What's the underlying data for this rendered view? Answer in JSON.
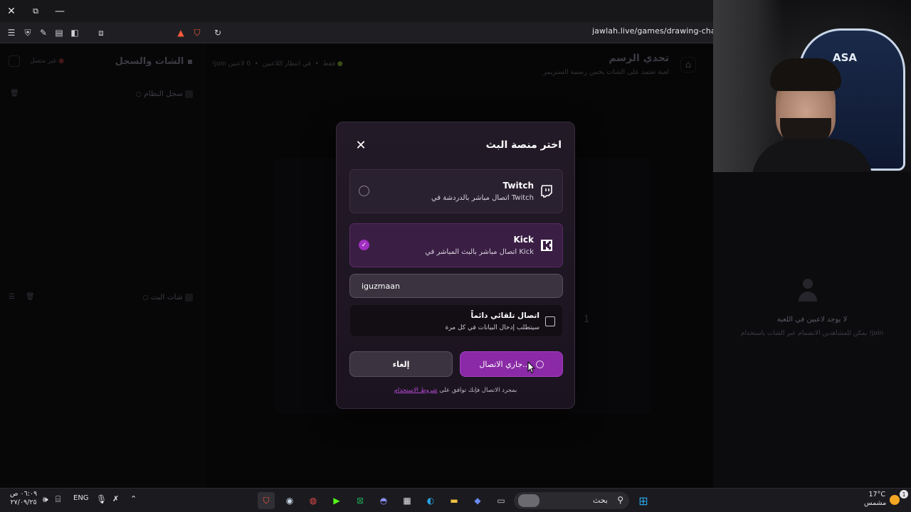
{
  "browser": {
    "url": "jawlah.live/games/drawing-challe"
  },
  "page": {
    "title": "تحدي الرسم",
    "subtitle": "لعبة تعتمد على الشات يخمن رسمة الستريمر",
    "status_players": "0 لاعبين",
    "status_waiting": "في انتظار اللاعبين",
    "status_join": "!join فقط",
    "chat_title": "الشات والسجل",
    "chat_status": "غير متصل",
    "system_log": "سجل النظام",
    "stream_chat": "شات البث",
    "round_number": "1",
    "no_players": "لا يوجد لاعبين في اللعبة",
    "no_players_hint": "يمكن للمشاهدين الانضمام عبر الشات باستخدام !join"
  },
  "modal": {
    "title": "اختر منصة البث",
    "twitch": {
      "name": "Twitch",
      "desc": "اتصال مباشر بالدردشة في Twitch"
    },
    "kick": {
      "name": "Kick",
      "desc": "اتصال مباشر بالبث المباشر في Kick"
    },
    "channel_value": "iguzmaan",
    "auto_title": "اتصال تلقائي دائماً",
    "auto_desc": "سيتطلب إدخال البيانات في كل مرة",
    "cancel_label": "إلغاء",
    "connect_label": "جاري الاتصال...",
    "terms_prefix": "بمجرد الاتصال فإنك توافق على",
    "terms_link": "شروط الاستخدام"
  },
  "webcam": {
    "badge": "ASA"
  },
  "taskbar": {
    "time": "٠٦:٠٩ ص",
    "date": "٢٧/٠٩/٢٥",
    "lang": "ENG",
    "search": "بحث",
    "weather_temp": "17°C",
    "weather_desc": "مشمس",
    "notif_count": "1"
  },
  "colors": {
    "accent": "#8a2aa6",
    "kick_green": "#53fc18",
    "twitch_purple": "#9146ff"
  }
}
